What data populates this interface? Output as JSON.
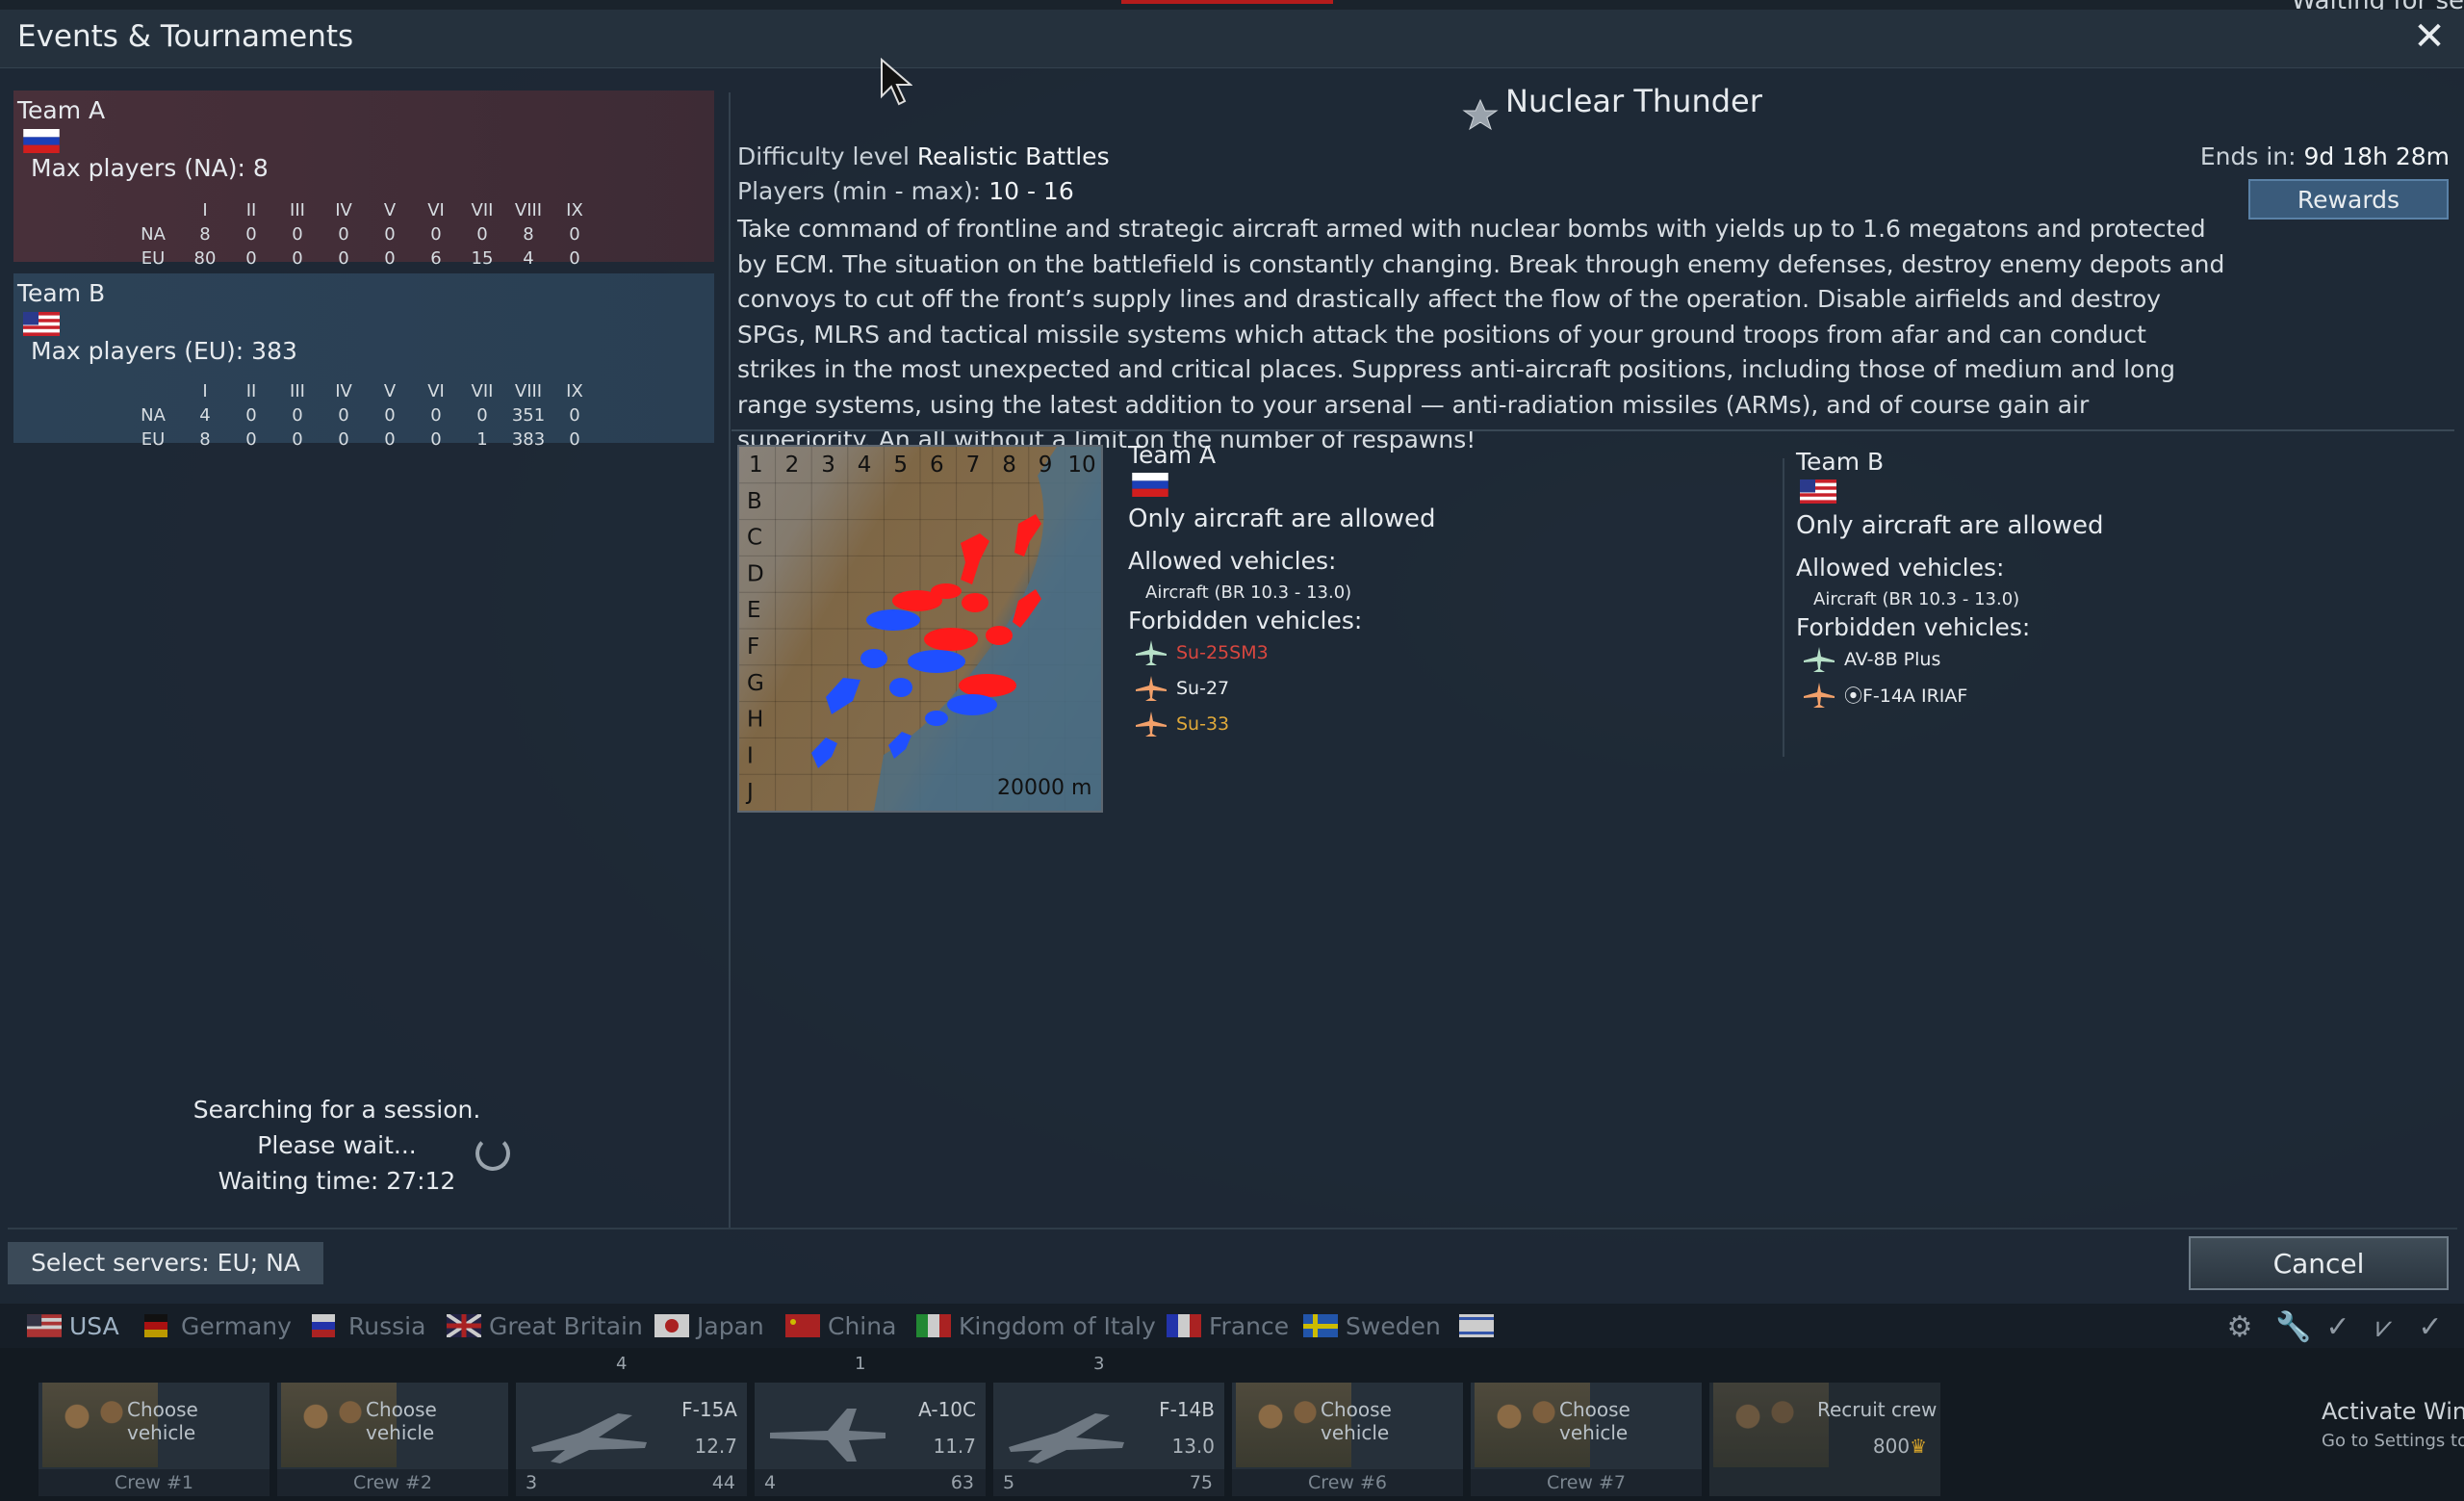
{
  "window": {
    "title": "Events & Tournaments",
    "top_status": "Waiting for se"
  },
  "left_panel": {
    "team_a": {
      "name": "Team A",
      "max_players": "Max players (NA): 8",
      "ranks": [
        "I",
        "II",
        "III",
        "IV",
        "V",
        "VI",
        "VII",
        "VIII",
        "IX"
      ],
      "rows": [
        {
          "region": "NA",
          "values": [
            "8",
            "0",
            "0",
            "0",
            "0",
            "0",
            "0",
            "8",
            "0"
          ]
        },
        {
          "region": "EU",
          "values": [
            "80",
            "0",
            "0",
            "0",
            "0",
            "6",
            "15",
            "4",
            "0"
          ]
        }
      ]
    },
    "team_b": {
      "name": "Team B",
      "max_players": "Max players (EU): 383",
      "ranks": [
        "I",
        "II",
        "III",
        "IV",
        "V",
        "VI",
        "VII",
        "VIII",
        "IX"
      ],
      "rows": [
        {
          "region": "NA",
          "values": [
            "4",
            "0",
            "0",
            "0",
            "0",
            "0",
            "0",
            "351",
            "0"
          ]
        },
        {
          "region": "EU",
          "values": [
            "8",
            "0",
            "0",
            "0",
            "0",
            "0",
            "1",
            "383",
            "0"
          ]
        }
      ]
    },
    "searching": {
      "line1": "Searching for a session.",
      "line2": "Please wait...",
      "line3": "Waiting time: 27:12"
    }
  },
  "event": {
    "name": "Nuclear Thunder",
    "difficulty_label": "Difficulty level",
    "difficulty_value": "Realistic Battles",
    "players_label": "Players (min - max):",
    "players_value": "10 - 16",
    "ends_label": "Ends in:",
    "ends_value": "9d 18h 28m",
    "rewards_label": "Rewards",
    "description": "Take command of frontline and strategic aircraft armed with nuclear bombs with yields up to 1.6 megatons and protected by ECM. The situation on the battlefield is constantly changing. Break through enemy defenses, destroy enemy depots and convoys to cut off the front’s supply lines and drastically affect the flow of the operation. Disable airfields and destroy SPGs, MLRS and tactical missile systems which attack the positions of your ground troops from afar and can conduct strikes in the most unexpected and critical places. Suppress anti-aircraft positions, including those of medium and long range systems, using the latest addition to your arsenal — anti-radiation missiles (ARMs), and of course gain air superiority. An all without a limit on the number of respawns!"
  },
  "map": {
    "columns": [
      "1",
      "2",
      "3",
      "4",
      "5",
      "6",
      "7",
      "8",
      "9",
      "10"
    ],
    "rows": [
      "B",
      "C",
      "D",
      "E",
      "F",
      "G",
      "H",
      "I",
      "J"
    ],
    "scale": "20000 m"
  },
  "teams_detail": {
    "team_a": {
      "name": "Team A",
      "only": "Only aircraft are allowed",
      "allowed_label": "Allowed vehicles:",
      "allowed": "Aircraft (BR 10.3 - 13.0)",
      "forbidden_label": "Forbidden vehicles:",
      "forbidden": [
        {
          "name": "Su-25SM3",
          "color": "#d9473f"
        },
        {
          "name": "Su-27",
          "color": "#e8ecef"
        },
        {
          "name": "Su-33",
          "color": "#e0a93a"
        }
      ]
    },
    "team_b": {
      "name": "Team B",
      "only": "Only aircraft are allowed",
      "allowed_label": "Allowed vehicles:",
      "allowed": "Aircraft (BR 10.3 - 13.0)",
      "forbidden_label": "Forbidden vehicles:",
      "forbidden": [
        {
          "name": "AV-8B Plus",
          "color": "#e8ecef"
        },
        {
          "name": "⦿F-14A IRIAF",
          "color": "#e8ecef"
        }
      ]
    }
  },
  "footer": {
    "servers_label": "Select servers: EU; NA",
    "cancel_label": "Cancel"
  },
  "countries": [
    "USA",
    "Germany",
    "Russia",
    "Great Britain",
    "Japan",
    "China",
    "Kingdom of Italy",
    "France",
    "Sweden"
  ],
  "crew_slots": [
    {
      "label": "Choose vehicle",
      "crew": "Crew #1"
    },
    {
      "label": "Choose vehicle",
      "crew": "Crew #2"
    },
    {
      "plane": "F-15A",
      "br": "12.7",
      "top": "4",
      "crew_no": "3",
      "cost": "44"
    },
    {
      "plane": "A-10C",
      "br": "11.7",
      "top": "1",
      "crew_no": "4",
      "cost": "63"
    },
    {
      "plane": "F-14B",
      "br": "13.0",
      "top": "3",
      "crew_no": "5",
      "cost": "75"
    },
    {
      "label": "Choose vehicle",
      "crew": "Crew #6"
    },
    {
      "label": "Choose vehicle",
      "crew": "Crew #7"
    },
    {
      "label": "Recruit crew",
      "price": "800"
    }
  ],
  "os": {
    "activate": "Activate Wind",
    "goto": "Go to Settings to a"
  },
  "colors": {
    "team_a_red": "#ff1a1a",
    "team_b_blue": "#1f4fff",
    "accent_button": "#3a5b7b"
  }
}
